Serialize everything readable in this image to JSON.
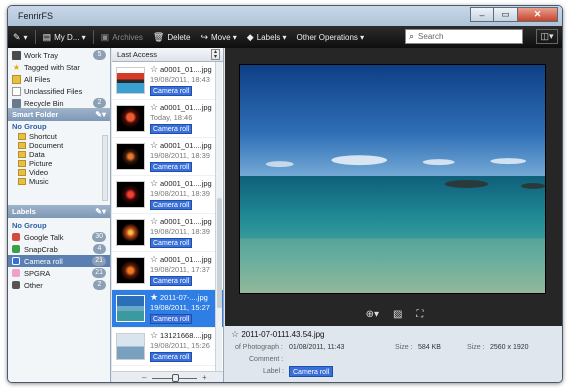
{
  "window": {
    "title": "FenrirFS",
    "min": "–",
    "max": "▭",
    "close": "✕"
  },
  "toolbar": {
    "menu_icon": "quill-icon",
    "profile_label": "My D...",
    "archives_label": "Archives",
    "delete_label": "Delete",
    "move_label": "Move",
    "labels_label": "Labels",
    "other_label": "Other Operations",
    "search_placeholder": "Search"
  },
  "sidebar": {
    "top_items": [
      {
        "label": "Work Tray",
        "count": "5"
      },
      {
        "label": "Tagged with Star",
        "count": ""
      },
      {
        "label": "All Files",
        "count": ""
      },
      {
        "label": "Unclassified Files",
        "count": ""
      },
      {
        "label": "Recycle Bin",
        "count": "2"
      }
    ],
    "smart_folder": {
      "title": "Smart Folder",
      "group": "No Group",
      "items": [
        "Shortcut",
        "Document",
        "Data",
        "Picture",
        "Video",
        "Music"
      ]
    },
    "labels": {
      "title": "Labels",
      "group": "No Group",
      "items": [
        {
          "label": "Google Talk",
          "count": "30",
          "color": "#d24a3c"
        },
        {
          "label": "SnapCrab",
          "count": "4",
          "color": "#3aa04a"
        },
        {
          "label": "Camera roll",
          "count": "21",
          "color": "#2f6fe0"
        },
        {
          "label": "SPGRA",
          "count": "21",
          "color": "#f0a0c8"
        },
        {
          "label": "Other",
          "count": "2",
          "color": "#555555"
        }
      ]
    }
  },
  "list": {
    "header": "Last Access",
    "items": [
      {
        "name": "a0001_01....jpg",
        "date": "19/08/2011, 18:43",
        "tag": "Camera roll",
        "starred": false
      },
      {
        "name": "a0001_01....jpg",
        "date": "Today, 18:46",
        "tag": "Camera roll",
        "starred": false
      },
      {
        "name": "a0001_01....jpg",
        "date": "19/08/2011, 18:39",
        "tag": "Camera roll",
        "starred": false
      },
      {
        "name": "a0001_01....jpg",
        "date": "19/08/2011, 18:39",
        "tag": "Camera roll",
        "starred": false
      },
      {
        "name": "a0001_01....jpg",
        "date": "19/08/2011, 18:39",
        "tag": "Camera roll",
        "starred": false
      },
      {
        "name": "a0001_01....jpg",
        "date": "19/08/2011, 17:37",
        "tag": "Camera roll",
        "starred": false
      },
      {
        "name": "2011-07-....jpg",
        "date": "19/08/2011, 15:27",
        "tag": "Camera roll",
        "starred": true
      },
      {
        "name": "13121668....jpg",
        "date": "19/08/2011, 15:26",
        "tag": "Camera roll",
        "starred": false
      }
    ]
  },
  "details": {
    "filename": "2011-07-0111.43.54.jpg",
    "photo_label": "of Photograph :",
    "photo_date": "01/08/2011, 11:43",
    "size_label": "Size :",
    "size_value": "584 KB",
    "dims_label": "Size :",
    "dims_value": "2560 x 1920",
    "comment_label": "Comment :",
    "label_label": "Label :",
    "label_value": "Camera roll"
  }
}
